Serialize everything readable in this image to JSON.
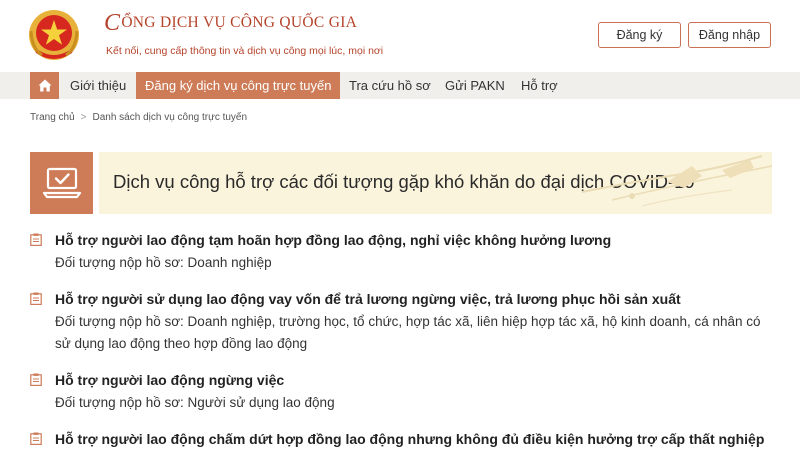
{
  "header": {
    "brand_title_initial": "C",
    "brand_title_rest": "ỔNG DỊCH VỤ CÔNG QUỐC GIA",
    "brand_subtitle": "Kết nối, cung cấp thông tin và dịch vụ công mọi lúc, mọi nơi",
    "register_label": "Đăng ký",
    "login_label": "Đăng nhập"
  },
  "nav": {
    "home_icon": "home-icon",
    "items": [
      {
        "label": "Giới thiệu"
      },
      {
        "label": "Đăng ký dịch vụ công trực tuyến"
      },
      {
        "label": "Tra cứu hồ sơ"
      },
      {
        "label": "Gửi PAKN"
      },
      {
        "label": "Hỗ trợ"
      }
    ],
    "active_index": 1
  },
  "breadcrumb": {
    "home": "Trang chủ",
    "separator": ">",
    "current": "Danh sách dịch vụ công trực tuyến"
  },
  "banner": {
    "title": "Dịch vụ công hỗ trợ các đối tượng gặp khó khăn do đại dịch COVID-19",
    "icon": "laptop-check-icon"
  },
  "services": [
    {
      "title": "Hỗ trợ người lao động tạm hoãn hợp đồng lao động, nghỉ việc không hưởng lương",
      "subject": "Đối tượng nộp hồ sơ: Doanh nghiệp"
    },
    {
      "title": "Hỗ trợ người sử dụng lao động vay vốn để trả lương ngừng việc, trả lương phục hồi sản xuất",
      "subject": "Đối tượng nộp hồ sơ: Doanh nghiệp, trường học, tổ chức, hợp tác xã, liên hiệp hợp tác xã, hộ kinh doanh, cá nhân có sử dụng lao động theo hợp đồng lao động"
    },
    {
      "title": "Hỗ trợ người lao động ngừng việc",
      "subject": "Đối tượng nộp hồ sơ: Người sử dụng lao động"
    },
    {
      "title": "Hỗ trợ người lao động chấm dứt hợp đồng lao động nhưng không đủ điều kiện hưởng trợ cấp thất nghiệp",
      "subject": ""
    }
  ],
  "colors": {
    "accent": "#ce7c57",
    "brand_red": "#b5432b",
    "banner_bg": "#fbf4dc",
    "nav_bg": "#f1efec"
  }
}
